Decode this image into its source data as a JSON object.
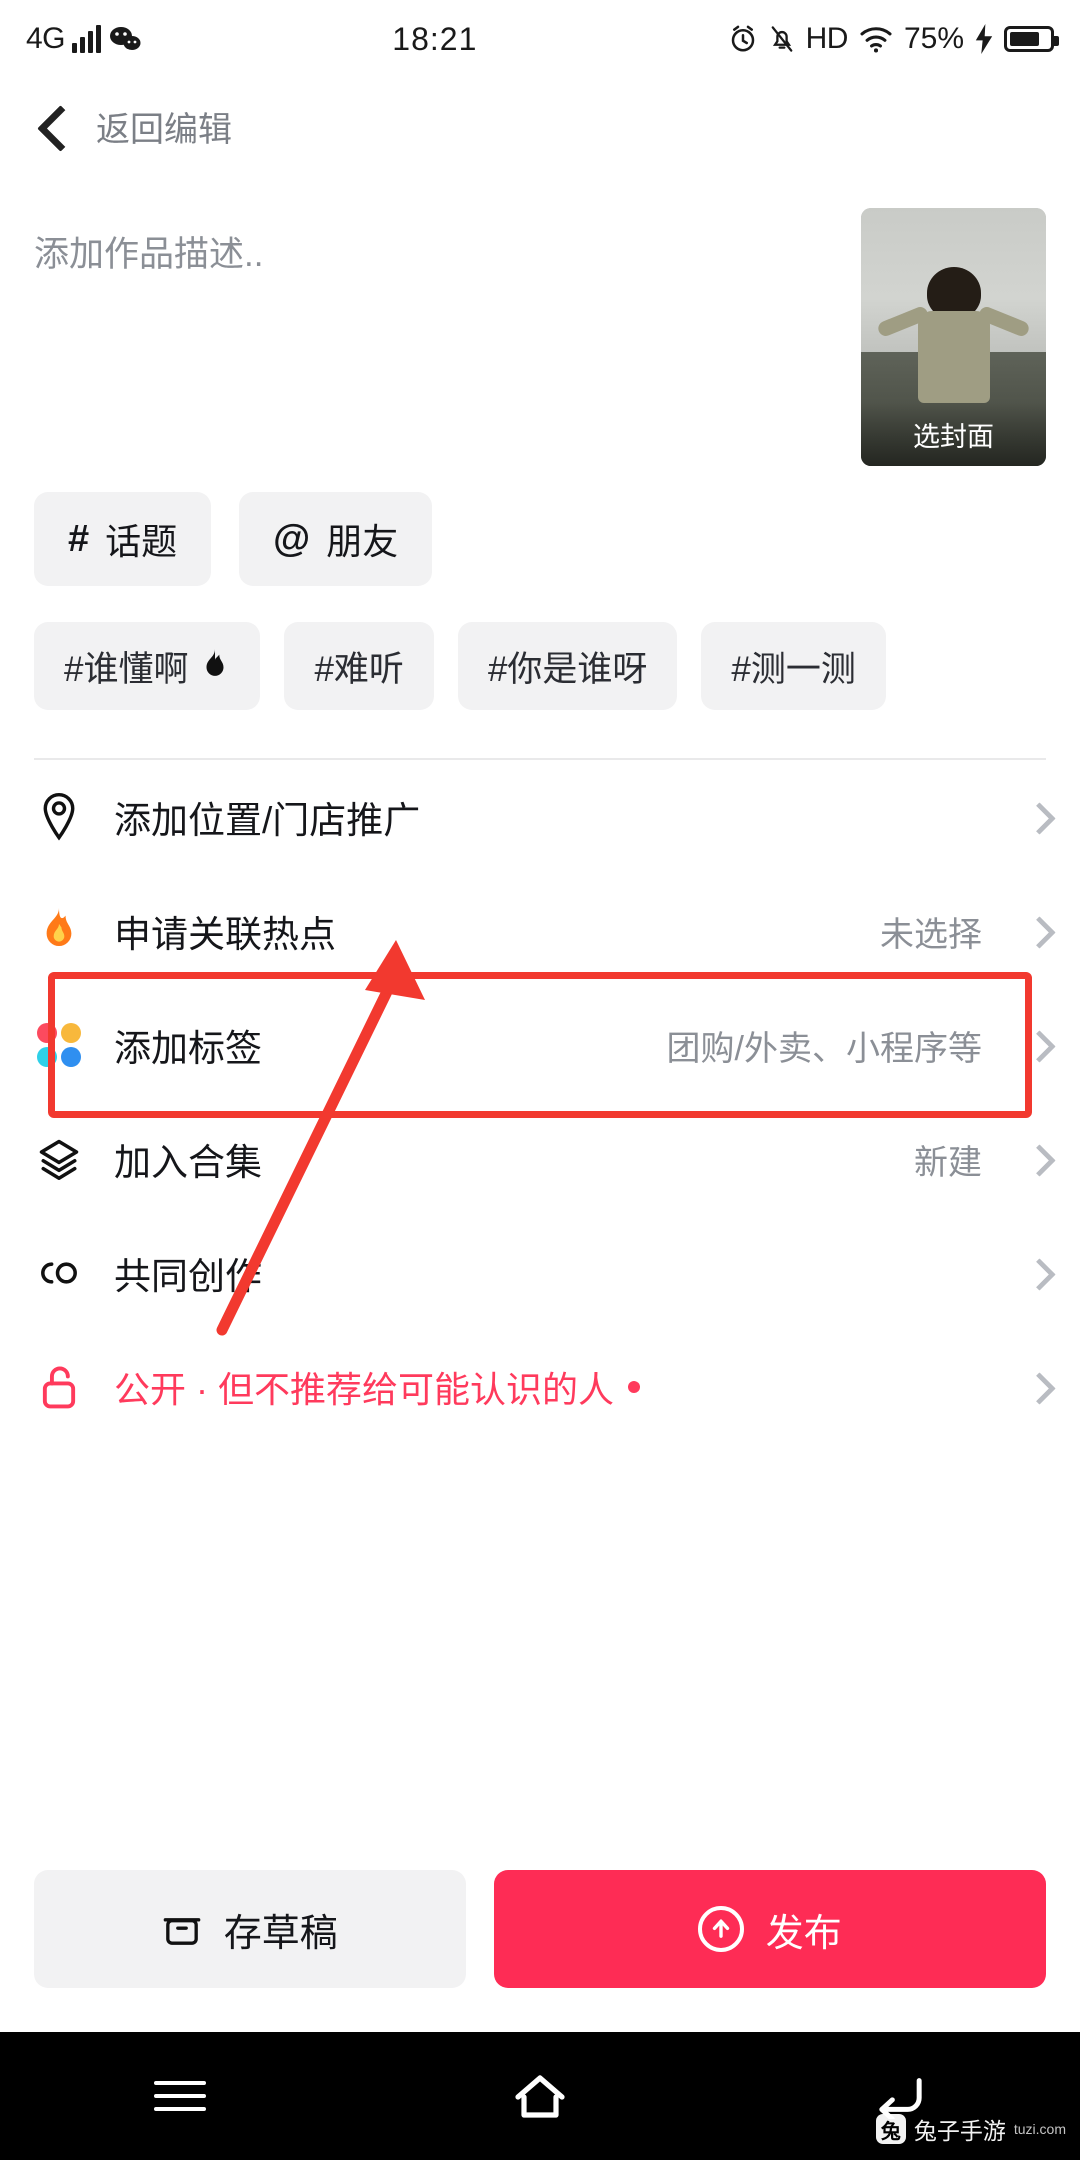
{
  "status_bar": {
    "network": "4G",
    "app_icon": "wechat-icon",
    "time": "18:21",
    "alarm_icon": "alarm-icon",
    "mute_icon": "mute-bell-icon",
    "hd_label": "HD",
    "wifi_icon": "wifi-icon",
    "battery_percent": "75%",
    "charging_icon": "lightning-icon"
  },
  "topnav": {
    "back_icon": "back-chevron-icon",
    "title": "返回编辑"
  },
  "description": {
    "placeholder": "添加作品描述..",
    "value": ""
  },
  "cover": {
    "label": "选封面"
  },
  "compose_buttons": [
    {
      "symbol": "#",
      "label": "话题",
      "icon": "hash-icon"
    },
    {
      "symbol": "@",
      "label": "朋友",
      "icon": "at-icon"
    }
  ],
  "hashtag_suggestions": [
    {
      "text": "#谁懂啊",
      "icon": "fire-icon"
    },
    {
      "text": "#难听",
      "icon": ""
    },
    {
      "text": "#你是谁呀",
      "icon": ""
    },
    {
      "text": "#测一测",
      "icon": ""
    }
  ],
  "menu_rows": [
    {
      "icon": "location-pin-icon",
      "label": "添加位置/门店推广",
      "value": "",
      "chevron": "chevron-right-icon"
    },
    {
      "icon": "fire-icon",
      "label": "申请关联热点",
      "value": "未选择",
      "chevron": "chevron-right-icon"
    },
    {
      "icon": "four-dots-icon",
      "label": "添加标签",
      "value": "团购/外卖、小程序等",
      "chevron": "chevron-right-icon",
      "highlighted": true
    },
    {
      "icon": "layers-icon",
      "label": "加入合集",
      "value": "新建",
      "chevron": "chevron-right-icon"
    },
    {
      "icon": "co-create-icon",
      "label": "共同创作",
      "value": "",
      "chevron": "chevron-right-icon"
    },
    {
      "icon": "unlock-icon",
      "label": "公开 · 但不推荐给可能认识的人",
      "value": "",
      "chevron": "chevron-right-icon",
      "privacy": true
    }
  ],
  "actions": {
    "draft_label": "存草稿",
    "draft_icon": "draft-box-icon",
    "publish_label": "发布",
    "publish_icon": "upload-arrow-icon"
  },
  "android_nav": {
    "recents_icon": "menu-icon",
    "home_icon": "home-icon",
    "back_icon": "back-arrow-icon"
  },
  "watermark": {
    "badge": "兔",
    "text": "兔子手游",
    "sub": "tuzi.com"
  },
  "colors": {
    "accent": "#fe2c55",
    "highlight": "#f2392f",
    "privacy": "#ff3a5c",
    "chip_bg": "#f2f2f3",
    "muted_text": "#8b8f96"
  }
}
